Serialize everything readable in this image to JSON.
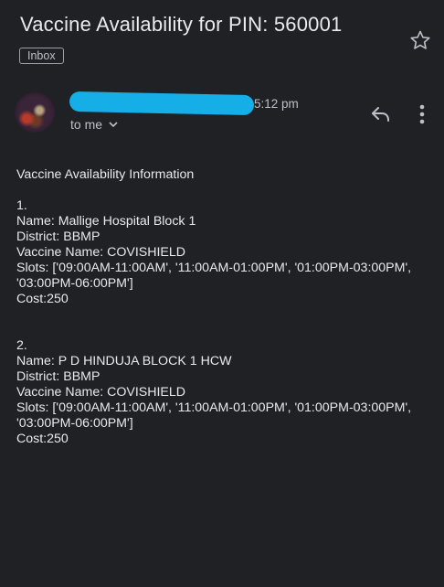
{
  "email": {
    "subject": "Vaccine Availability for PIN: 560001",
    "label": "Inbox",
    "time": "5:12 pm",
    "to": "to me",
    "heading": "Vaccine Availability Information",
    "entries": [
      {
        "number": "1.",
        "name": "Name: Mallige Hospital Block 1",
        "district": "District: BBMP",
        "vaccine": "Vaccine Name: COVISHIELD",
        "slots": "Slots: ['09:00AM-11:00AM', '11:00AM-01:00PM', '01:00PM-03:00PM', '03:00PM-06:00PM']",
        "cost": "Cost:250"
      },
      {
        "number": "2.",
        "name": "Name: P D HINDUJA BLOCK 1 HCW",
        "district": "District: BBMP",
        "vaccine": "Vaccine Name: COVISHIELD",
        "slots": "Slots: ['09:00AM-11:00AM', '11:00AM-01:00PM', '01:00PM-03:00PM', '03:00PM-06:00PM']",
        "cost": "Cost:250"
      }
    ]
  },
  "icons": {
    "star": "star-outline-icon",
    "reply": "reply-icon",
    "more": "more-vert-icon",
    "chevron": "chevron-down-icon"
  },
  "colors": {
    "background": "#1f2124",
    "text": "#e8eaed",
    "secondary_text": "#bdc1c6",
    "redaction": "#16aee6"
  }
}
